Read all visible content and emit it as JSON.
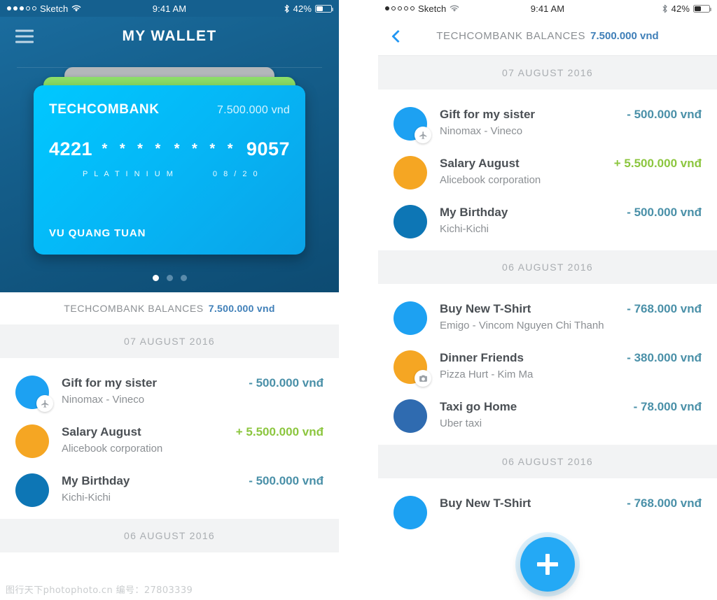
{
  "status_bar_left": {
    "carrier": "Sketch",
    "signal_filled": 3,
    "signal_total": 5,
    "time": "9:41 AM",
    "battery_percent": "42%",
    "bluetooth_icon": "bluetooth-icon",
    "wifi_icon": "wifi-icon"
  },
  "status_bar_right": {
    "carrier": "Sketch",
    "signal_filled": 1,
    "signal_total": 5,
    "time": "9:41 AM",
    "battery_percent": "42%",
    "bluetooth_icon": "bluetooth-icon",
    "wifi_icon": "wifi-icon"
  },
  "left_screen": {
    "nav": {
      "title": "MY WALLET",
      "menu_icon": "hamburger-menu-icon"
    },
    "card": {
      "bank_name": "TECHCOMBANK",
      "balance": "7.500.000 vnd",
      "number_first": "4221",
      "number_mask_1": "* * * *",
      "number_mask_2": "* * * *",
      "number_last": "9057",
      "tier": "P L A T I N I U M",
      "expiry": "0 8 / 2 0",
      "holder": "VU QUANG TUAN",
      "color_main": "#05b8f7",
      "color_stack_green": "#7ed957",
      "color_stack_gray": "#b3b7ba"
    },
    "pager": {
      "total": 3,
      "active_index": 0
    },
    "balances": {
      "label": "TECHCOMBANK BALANCES",
      "value": "7.500.000 vnd"
    },
    "sections": [
      {
        "date": "07 AUGUST 2016",
        "transactions": [
          {
            "title": "Gift for my sister",
            "subtitle": "Ninomax - Vineco",
            "amount": "- 500.000 vnđ",
            "sign": "neg",
            "avatar_color": "#1da1f2",
            "badge_icon": "airplane-icon"
          },
          {
            "title": "Salary August",
            "subtitle": "Alicebook corporation",
            "amount": "+ 5.500.000 vnđ",
            "sign": "pos",
            "avatar_color": "#f5a623",
            "badge_icon": ""
          },
          {
            "title": "My Birthday",
            "subtitle": "Kichi-Kichi",
            "amount": "- 500.000 vnđ",
            "sign": "neg",
            "avatar_color": "#0d76b5",
            "badge_icon": ""
          }
        ]
      },
      {
        "date": "06 AUGUST 2016",
        "transactions": []
      }
    ]
  },
  "right_screen": {
    "nav": {
      "back_icon": "chevron-left-icon",
      "label": "TECHCOMBANK BALANCES",
      "value": "7.500.000 vnd"
    },
    "sections": [
      {
        "date": "07 AUGUST 2016",
        "transactions": [
          {
            "title": "Gift for my sister",
            "subtitle": "Ninomax - Vineco",
            "amount": "- 500.000 vnđ",
            "sign": "neg",
            "avatar_color": "#1da1f2",
            "badge_icon": "airplane-icon"
          },
          {
            "title": "Salary August",
            "subtitle": "Alicebook corporation",
            "amount": "+ 5.500.000 vnđ",
            "sign": "pos",
            "avatar_color": "#f5a623",
            "badge_icon": ""
          },
          {
            "title": "My Birthday",
            "subtitle": "Kichi-Kichi",
            "amount": "- 500.000 vnđ",
            "sign": "neg",
            "avatar_color": "#0d76b5",
            "badge_icon": ""
          }
        ]
      },
      {
        "date": "06 AUGUST 2016",
        "transactions": [
          {
            "title": "Buy New T-Shirt",
            "subtitle": "Emigo - Vincom Nguyen Chi Thanh",
            "amount": "- 768.000 vnđ",
            "sign": "neg",
            "avatar_color": "#1da1f2",
            "badge_icon": ""
          },
          {
            "title": "Dinner Friends",
            "subtitle": "Pizza Hurt - Kim Ma",
            "amount": "- 380.000 vnđ",
            "sign": "neg",
            "avatar_color": "#f5a623",
            "badge_icon": "camera-icon"
          },
          {
            "title": "Taxi go Home",
            "subtitle": "Uber taxi",
            "amount": "- 78.000 vnđ",
            "sign": "neg",
            "avatar_color": "#2f6bb0",
            "badge_icon": ""
          }
        ]
      },
      {
        "date": "06 AUGUST 2016",
        "transactions": [
          {
            "title": "Buy New T-Shirt",
            "subtitle": "",
            "amount": "- 768.000 vnđ",
            "sign": "neg",
            "avatar_color": "#1da1f2",
            "badge_icon": ""
          }
        ]
      }
    ],
    "fab": {
      "icon": "plus-icon",
      "color": "#24a9f5"
    }
  },
  "watermark": {
    "text": "图行天下photophoto.cn  编号：27803339"
  }
}
